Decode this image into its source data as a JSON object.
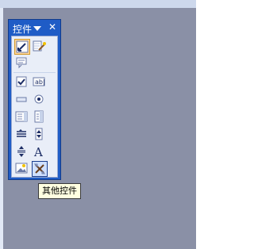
{
  "toolbox": {
    "title": "控件",
    "tooltip": "其他控件",
    "tools": [
      {
        "name": "select-objects",
        "icon": "arrow-pointer-icon",
        "selected": true
      },
      {
        "name": "control-wizard",
        "icon": "wand-icon"
      },
      {
        "name": "label",
        "icon": "label-icon"
      },
      {
        "name": "checkbox",
        "icon": "checkbox-icon"
      },
      {
        "name": "textbox",
        "icon": "textbox-icon",
        "text": "ab|"
      },
      {
        "name": "command-button",
        "icon": "button-icon"
      },
      {
        "name": "option-button",
        "icon": "radio-icon"
      },
      {
        "name": "list-box",
        "icon": "list-box-icon"
      },
      {
        "name": "combo-box",
        "icon": "combo-box-icon"
      },
      {
        "name": "scroll-bar",
        "icon": "scroll-bar-icon"
      },
      {
        "name": "spin-button",
        "icon": "spin-button-icon"
      },
      {
        "name": "toggle-button",
        "icon": "toggle-button-icon"
      },
      {
        "name": "font",
        "icon": "font-a-icon",
        "text": "A"
      },
      {
        "name": "image",
        "icon": "image-icon"
      },
      {
        "name": "more-controls",
        "icon": "more-controls-icon",
        "hovered": true
      }
    ]
  }
}
